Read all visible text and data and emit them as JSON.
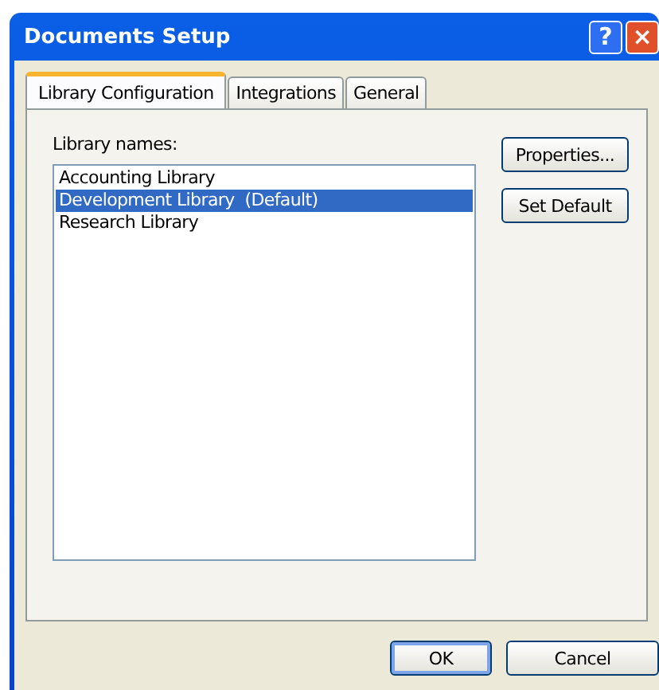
{
  "window": {
    "title": "Documents Setup"
  },
  "title_buttons": [
    {
      "kind": "help",
      "label": "?"
    },
    {
      "kind": "close",
      "label": "×"
    }
  ],
  "tabs": [
    {
      "label": "Library Configuration",
      "selected": true
    },
    {
      "label": "Integrations",
      "selected": false
    },
    {
      "label": "General",
      "selected": false
    }
  ],
  "library_list": {
    "label": "Library names:",
    "items": [
      {
        "label": "Accounting Library",
        "selected": false
      },
      {
        "label": "Development Library  (Default)",
        "selected": true
      },
      {
        "label": "Research Library",
        "selected": false
      }
    ]
  },
  "side_buttons": [
    "Properties...",
    "Set Default"
  ],
  "buttons": [
    {
      "label": "OK",
      "default": true
    },
    {
      "label": "Cancel",
      "default": false
    }
  ]
}
